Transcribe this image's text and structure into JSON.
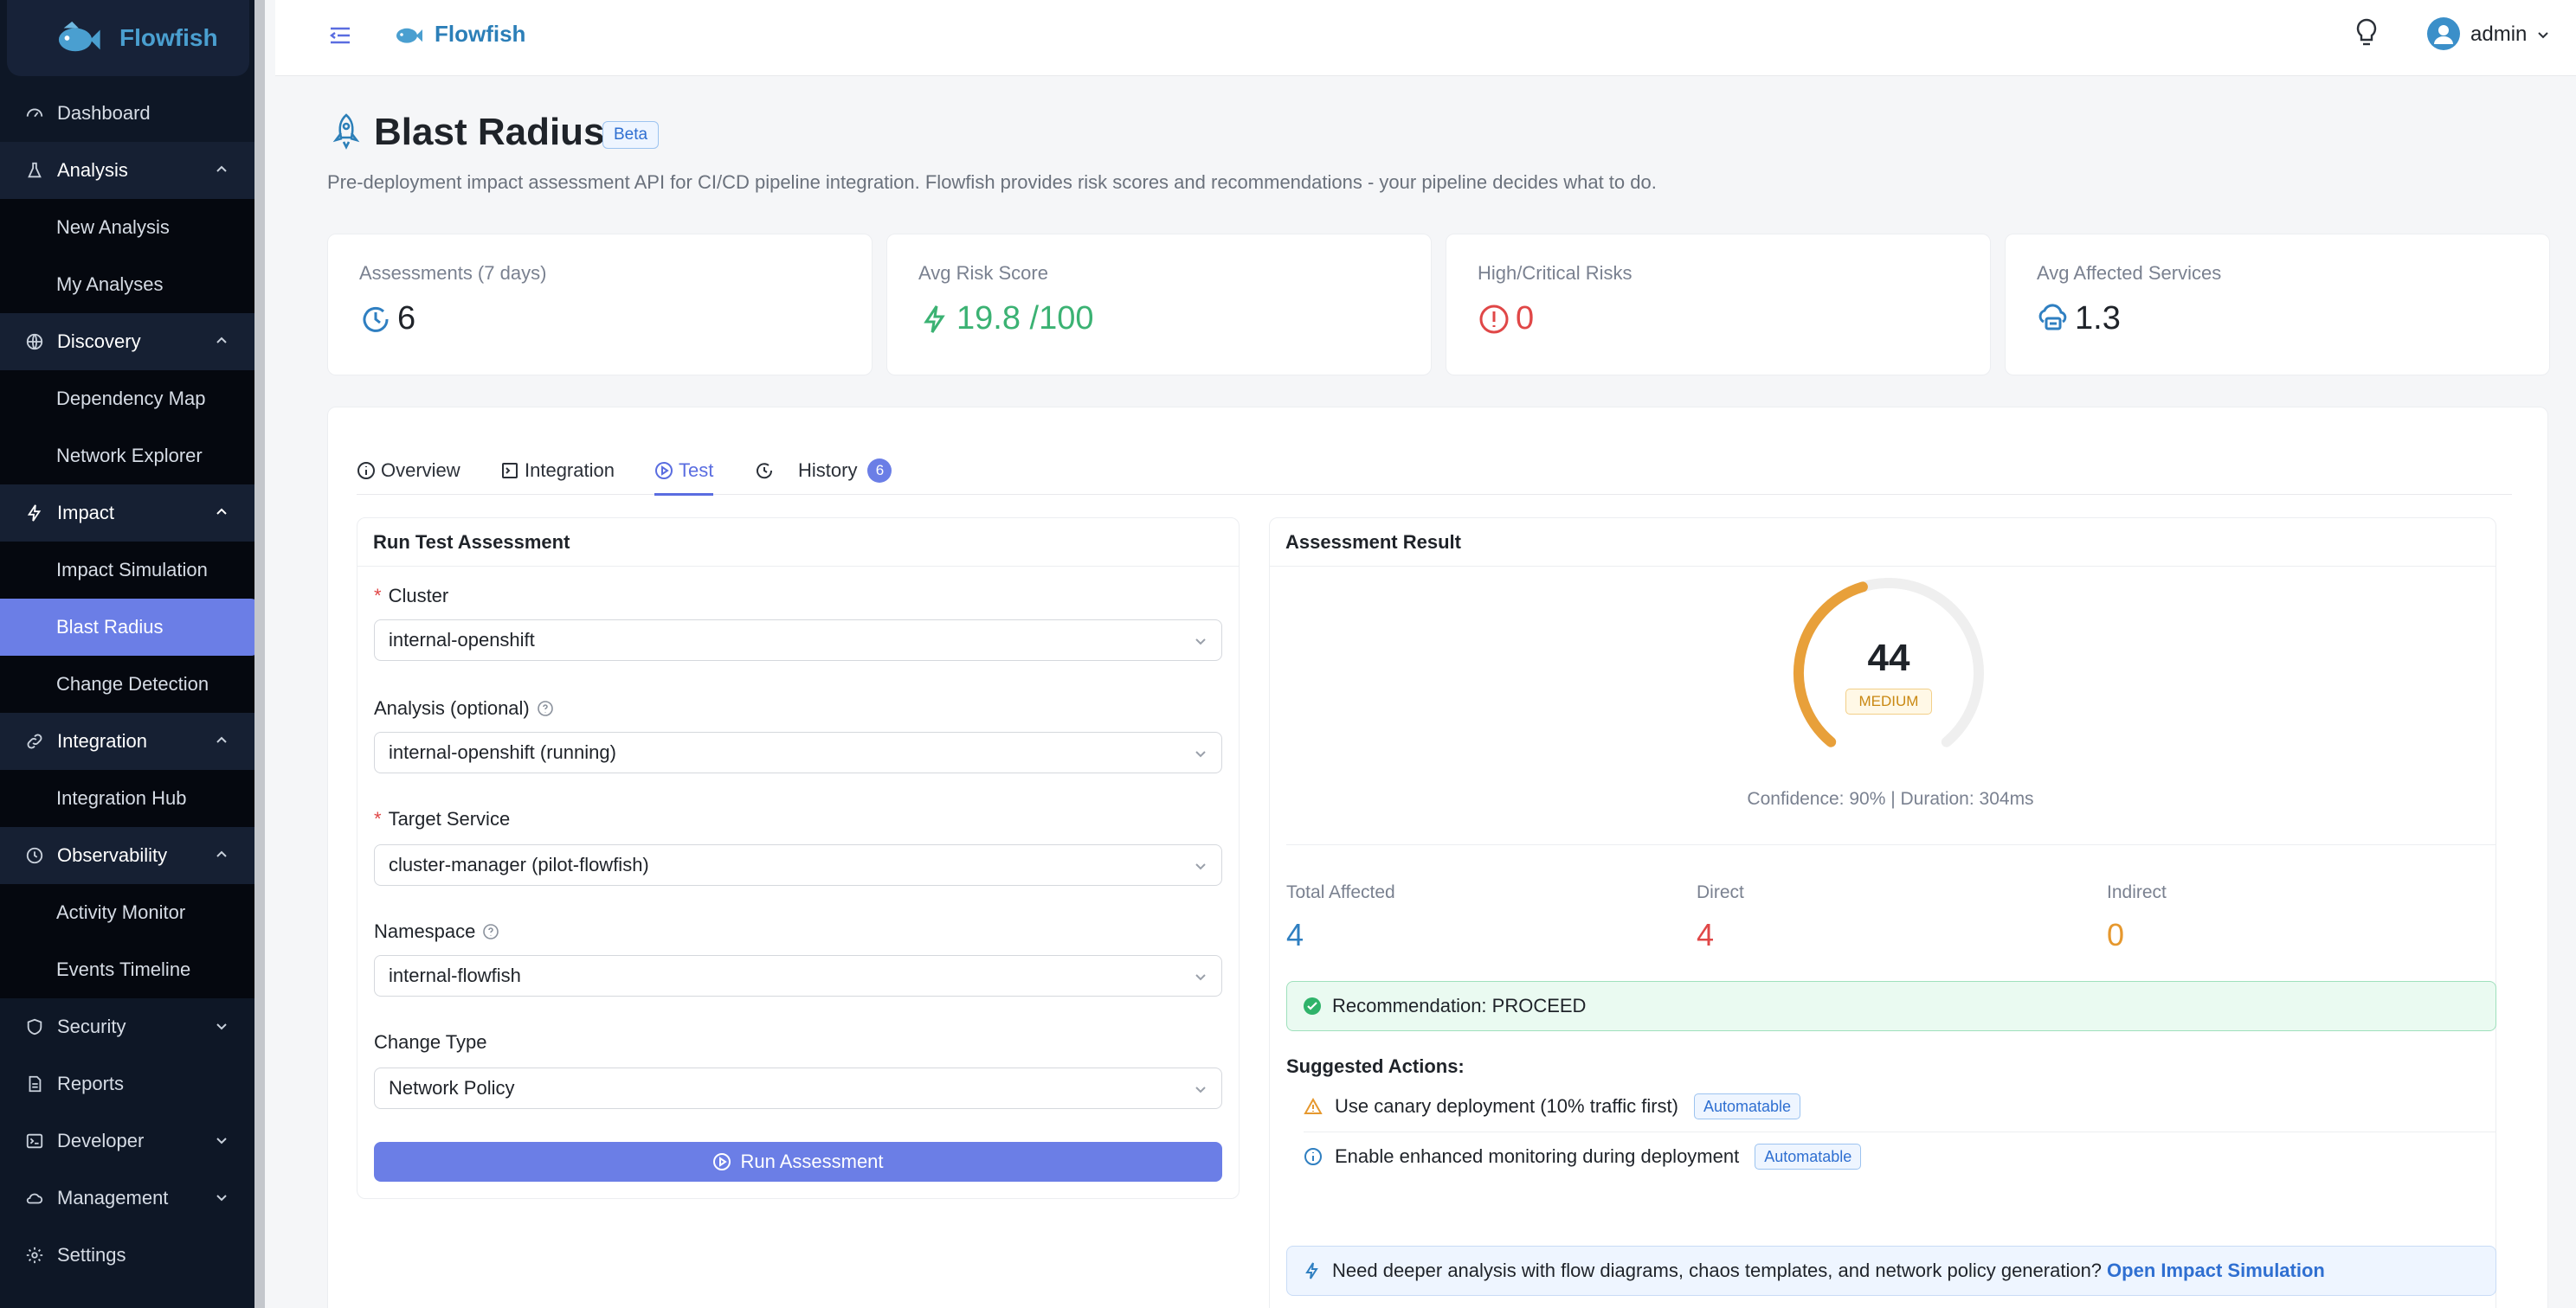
{
  "app": {
    "name": "Flowfish"
  },
  "sidebar": {
    "items": [
      {
        "label": "Dashboard",
        "icon": "dashboard-icon"
      },
      {
        "label": "Analysis",
        "icon": "flask-icon",
        "open": true,
        "children": [
          "New Analysis",
          "My Analyses"
        ]
      },
      {
        "label": "Discovery",
        "icon": "globe-icon",
        "open": true,
        "children": [
          "Dependency Map",
          "Network Explorer"
        ]
      },
      {
        "label": "Impact",
        "icon": "lightning-icon",
        "open": true,
        "children": [
          "Impact Simulation",
          "Blast Radius",
          "Change Detection"
        ]
      },
      {
        "label": "Integration",
        "icon": "link-icon",
        "open": true,
        "children": [
          "Integration Hub"
        ]
      },
      {
        "label": "Observability",
        "icon": "clock-icon",
        "open": true,
        "children": [
          "Activity Monitor",
          "Events Timeline"
        ]
      },
      {
        "label": "Security",
        "icon": "shield-icon"
      },
      {
        "label": "Reports",
        "icon": "document-icon"
      },
      {
        "label": "Developer",
        "icon": "terminal-icon"
      },
      {
        "label": "Management",
        "icon": "cloud-icon"
      },
      {
        "label": "Settings",
        "icon": "gear-icon"
      }
    ],
    "active": "Blast Radius"
  },
  "header": {
    "title": "Flowfish",
    "user": "admin"
  },
  "page": {
    "title": "Blast Radius",
    "badge": "Beta",
    "description": "Pre-deployment impact assessment API for CI/CD pipeline integration. Flowfish provides risk scores and recommendations - your pipeline decides what to do."
  },
  "stats": [
    {
      "label": "Assessments (7 days)",
      "value": "6",
      "icon": "clock-icon",
      "color": "#1f2329"
    },
    {
      "label": "Avg Risk Score",
      "value": "19.8 /100",
      "icon": "lightning-icon",
      "color": "#3bb273"
    },
    {
      "label": "High/Critical Risks",
      "value": "0",
      "icon": "alert-icon",
      "color": "#e04747"
    },
    {
      "label": "Avg Affected Services",
      "value": "1.3",
      "icon": "cloud-server-icon",
      "color": "#1f2329"
    }
  ],
  "tabs": [
    {
      "label": "Overview",
      "icon": "info-icon"
    },
    {
      "label": "Integration",
      "icon": "code-icon"
    },
    {
      "label": "Test",
      "icon": "play-icon",
      "active": true
    },
    {
      "label": "History",
      "icon": "history-icon",
      "count": "6"
    }
  ],
  "form": {
    "title": "Run Test Assessment",
    "cluster": {
      "label": "Cluster",
      "value": "internal-openshift"
    },
    "analysis": {
      "label": "Analysis (optional)",
      "value": "internal-openshift (running)"
    },
    "target": {
      "label": "Target Service",
      "value": "cluster-manager (pilot-flowfish)"
    },
    "namespace": {
      "label": "Namespace",
      "value": "internal-flowfish"
    },
    "change_type": {
      "label": "Change Type",
      "value": "Network Policy"
    },
    "run_label": "Run Assessment"
  },
  "result": {
    "title": "Assessment Result",
    "score": "44",
    "score_fraction": 0.44,
    "level": "MEDIUM",
    "meta": "Confidence: 90% | Duration: 304ms",
    "affected": [
      {
        "label": "Total Affected",
        "value": "4",
        "color": "#2f7fc1"
      },
      {
        "label": "Direct",
        "value": "4",
        "color": "#e04747"
      },
      {
        "label": "Indirect",
        "value": "0",
        "color": "#e6982e"
      }
    ],
    "recommendation": "Recommendation: PROCEED",
    "suggested_title": "Suggested Actions:",
    "suggested": [
      {
        "text": "Use canary deployment (10% traffic first)",
        "tag": "Automatable",
        "icon": "warning-icon"
      },
      {
        "text": "Enable enhanced monitoring during deployment",
        "tag": "Automatable",
        "icon": "info-icon"
      }
    ],
    "deeper_text": "Need deeper analysis with flow diagrams, chaos templates, and network policy generation?",
    "deeper_link": "Open Impact Simulation"
  }
}
